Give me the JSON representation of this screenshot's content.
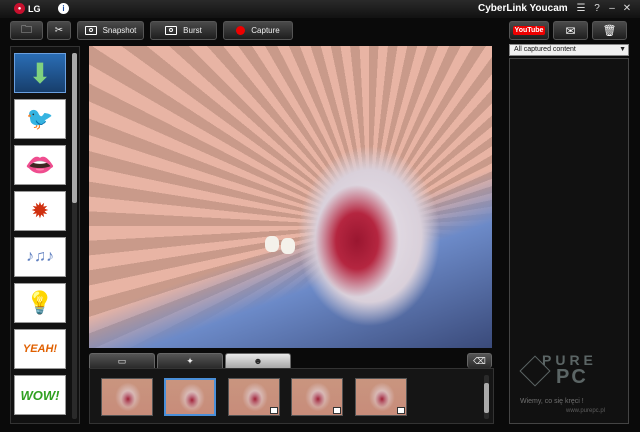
{
  "titlebar": {
    "brand": "LG",
    "app_title": "CyberLink Youcam",
    "buttons": [
      "menu-icon",
      "help-icon",
      "minimize-icon",
      "close-icon"
    ]
  },
  "toolbar": {
    "snapshot_label": "Snapshot",
    "burst_label": "Burst",
    "capture_label": "Capture"
  },
  "effects": {
    "items": [
      "download-arrow",
      "bird",
      "lips",
      "punch",
      "music-notes",
      "lightbulb",
      "yeah-text",
      "wow-text"
    ]
  },
  "effect_text": {
    "yeah": "YEAH!",
    "wow": "WOW!"
  },
  "bottom_tabs": [
    "frame-tab-icon",
    "magic-wand-tab-icon",
    "face-tab-icon"
  ],
  "right_panel": {
    "youtube_label": "YouTube",
    "dropdown_value": "All captured content"
  },
  "watermark": {
    "brand_top": "PURE",
    "brand_bottom": "PC",
    "tagline": "Wiemy, co się kręci !",
    "url": "www.purepc.pl"
  },
  "colors": {
    "accent_blue": "#4a8fd8",
    "capture_red": "#e00000",
    "lg_red": "#c8102e"
  }
}
